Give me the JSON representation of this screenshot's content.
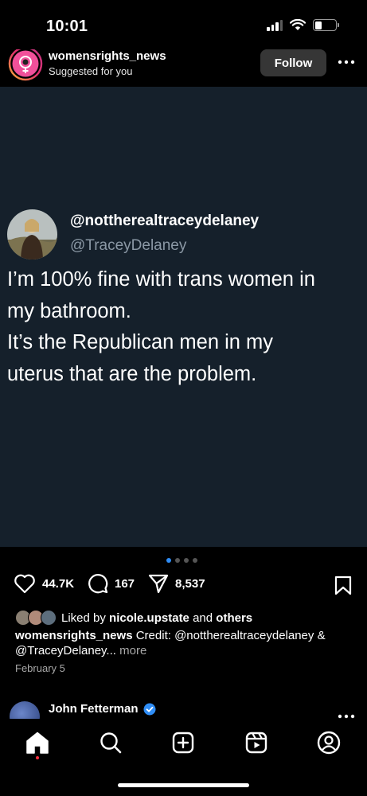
{
  "status_bar": {
    "time": "10:01"
  },
  "post": {
    "username": "womensrights_news",
    "subtitle": "Suggested for you",
    "follow_label": "Follow",
    "more_icon": "more-horizontal-icon"
  },
  "tweet": {
    "display_name": "@nottherealtraceydelaney",
    "handle": "@TraceyDelaney",
    "lines": [
      "I’m 100% fine with trans women in",
      "my bathroom.",
      "It’s the Republican men in my",
      "uterus that are the problem."
    ],
    "background": "#15202b"
  },
  "carousel": {
    "count": 4,
    "active_index": 0,
    "active_color": "#2f8df6"
  },
  "actions": {
    "likes": "44.7K",
    "comments": "167",
    "shares": "8,537"
  },
  "liked_by": {
    "prefix": "Liked by",
    "user": "nicole.upstate",
    "and": "and",
    "others": "others"
  },
  "caption": {
    "user": "womensrights_news",
    "text": "Credit: @nottherealtraceydelaney & @TraceyDelaney...",
    "more": "more"
  },
  "date": "February 5",
  "next_post": {
    "username": "John Fetterman",
    "verified": true
  },
  "bottom_nav": {
    "items": [
      "home-icon",
      "search-icon",
      "create-icon",
      "reels-icon",
      "profile-icon"
    ],
    "active": "home-icon"
  },
  "colors": {
    "accent": "#2f8df6",
    "notification": "#ff3040",
    "follow_bg": "#363636"
  }
}
